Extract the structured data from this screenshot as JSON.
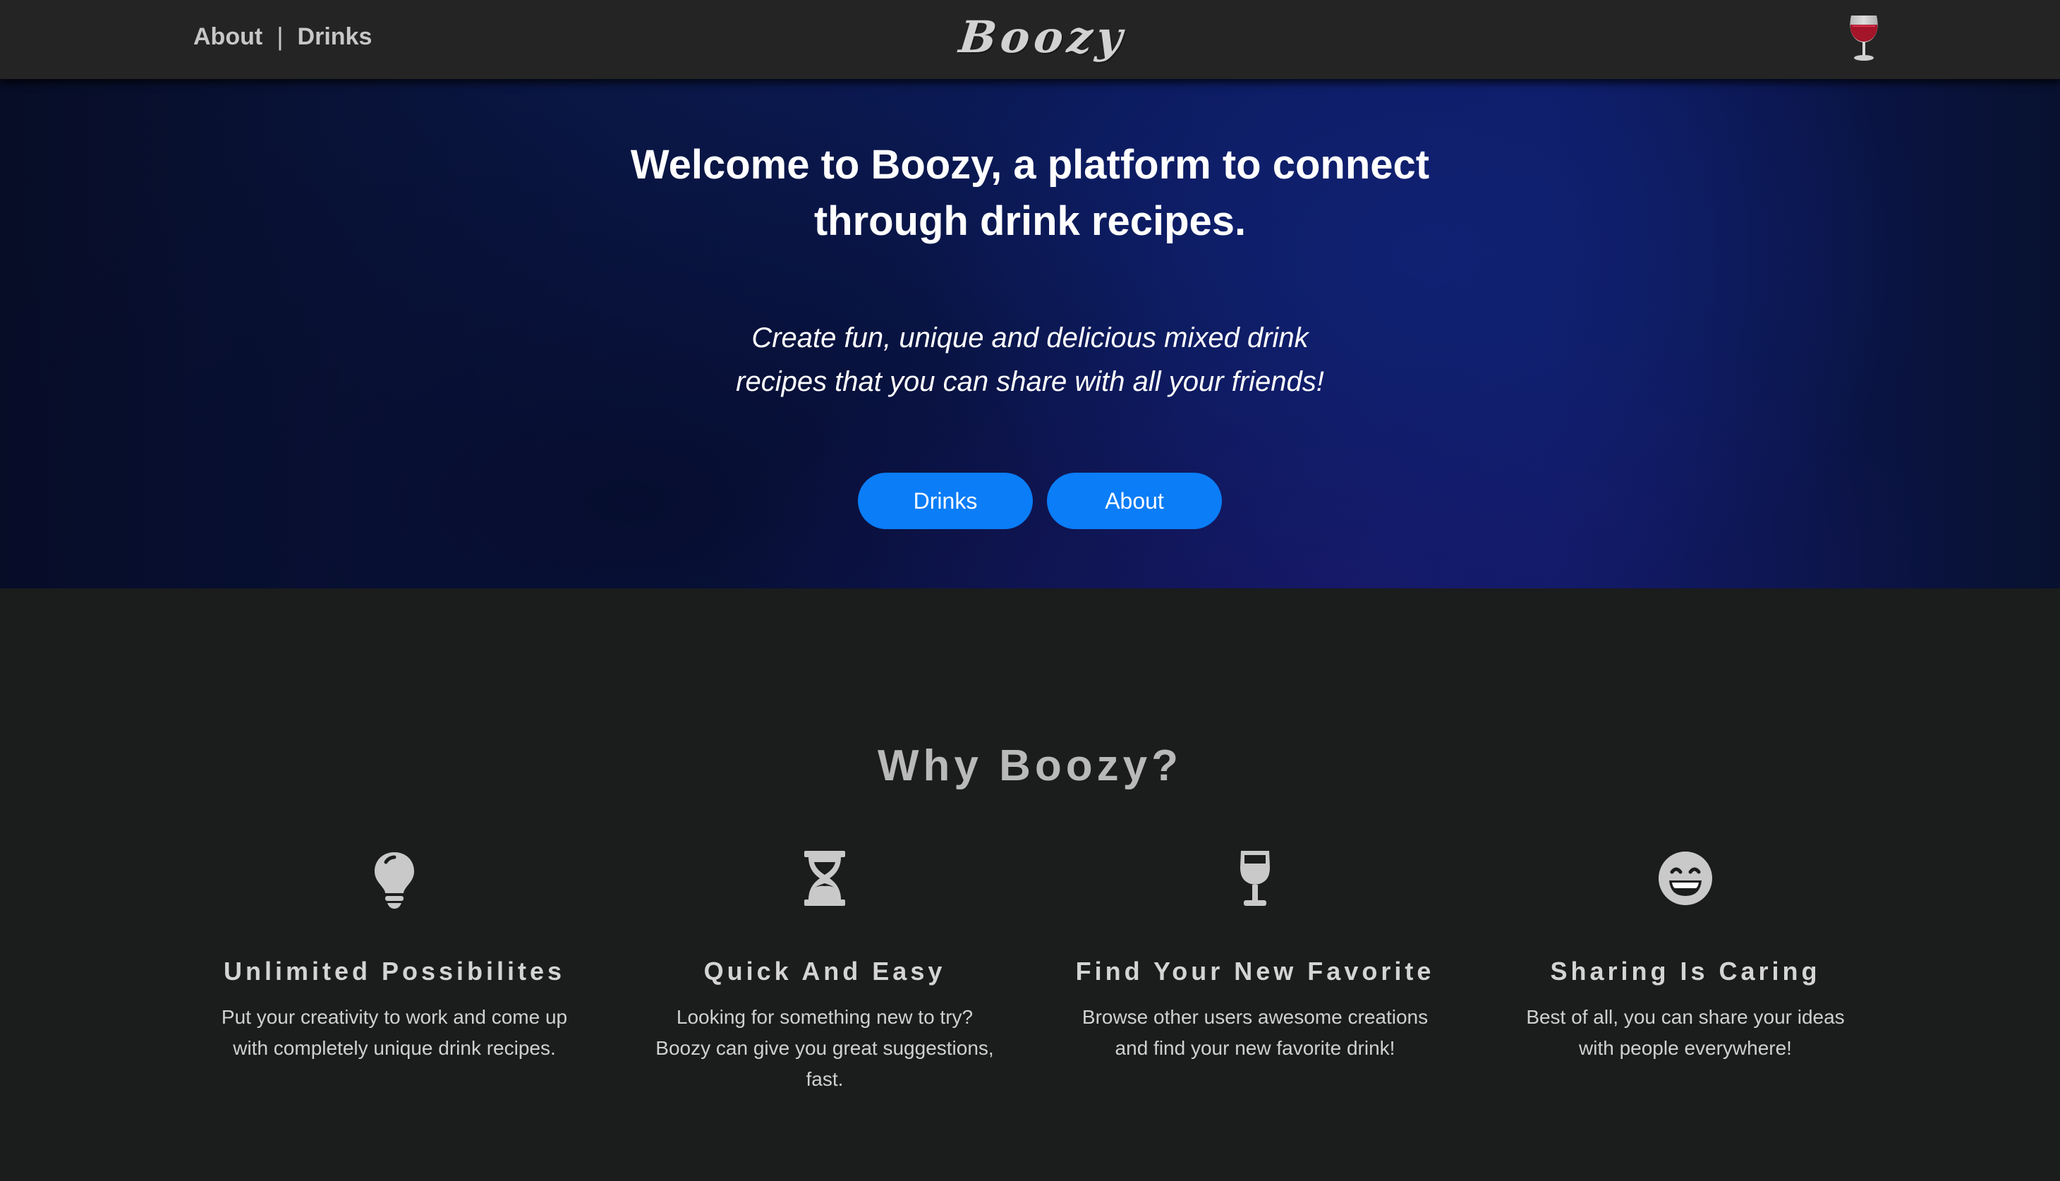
{
  "nav": {
    "about_label": "About",
    "separator": "|",
    "drinks_label": "Drinks",
    "brand": "Boozy",
    "wine_icon": "wine-glass-icon"
  },
  "hero": {
    "title": "Welcome to Boozy, a platform to connect through drink recipes.",
    "subtitle": "Create fun, unique and delicious mixed drink recipes that you can share with all your friends!",
    "buttons": {
      "drinks_label": "Drinks",
      "about_label": "About"
    },
    "button_color": "#0a7df7"
  },
  "why": {
    "title": "Why Boozy?",
    "features": [
      {
        "icon": "lightbulb-icon",
        "title": "Unlimited Possibilites",
        "text": "Put your creativity to work and come up with completely unique drink recipes."
      },
      {
        "icon": "hourglass-icon",
        "title": "Quick And Easy",
        "text": "Looking for something new to try? Boozy can give you great suggestions, fast."
      },
      {
        "icon": "wine-glass-icon",
        "title": "Find Your New Favorite",
        "text": "Browse other users awesome creations and find your new favorite drink!"
      },
      {
        "icon": "grin-icon",
        "title": "Sharing Is Caring",
        "text": "Best of all, you can share your ideas with people everywhere!"
      }
    ]
  }
}
